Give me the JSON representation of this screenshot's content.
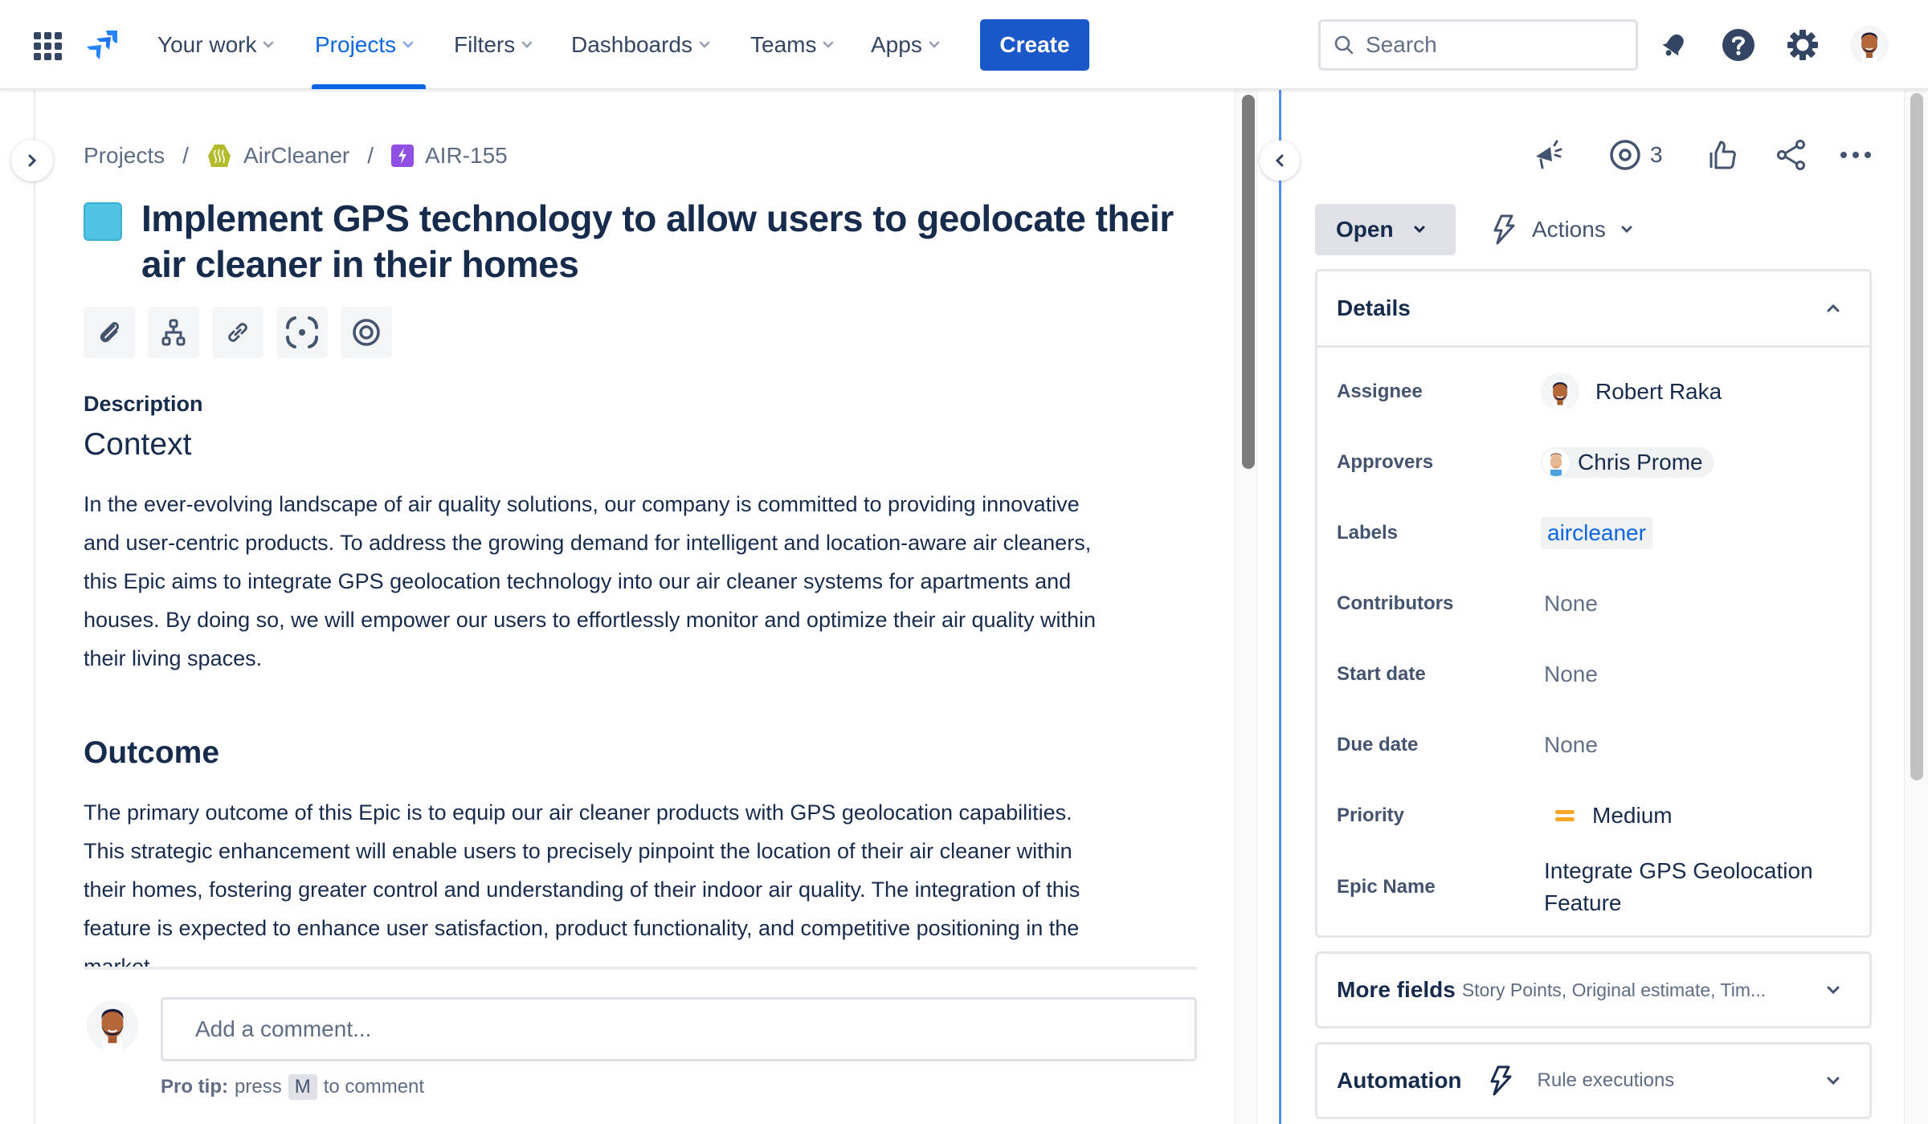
{
  "header": {
    "nav": [
      {
        "label": "Your work",
        "active": false
      },
      {
        "label": "Projects",
        "active": true
      },
      {
        "label": "Filters",
        "active": false
      },
      {
        "label": "Dashboards",
        "active": false
      },
      {
        "label": "Teams",
        "active": false
      },
      {
        "label": "Apps",
        "active": false
      }
    ],
    "create_label": "Create",
    "search_placeholder": "Search",
    "icons": [
      "app-switcher-icon",
      "jira-logo",
      "notifications-icon",
      "help-icon",
      "settings-icon",
      "profile-avatar"
    ],
    "accent_color": "#0c66e4"
  },
  "breadcrumb": {
    "items": [
      "Projects",
      "AirCleaner",
      "AIR-155"
    ],
    "separator": "/"
  },
  "issue": {
    "title": "Implement GPS technology to allow users to geolocate their air cleaner in their homes",
    "type_color": "#4fc3e3",
    "toolbar": [
      {
        "name": "attachment-icon"
      },
      {
        "name": "child-issues-icon"
      },
      {
        "name": "link-issue-icon"
      },
      {
        "name": "screen-record-icon"
      },
      {
        "name": "target-icon"
      }
    ],
    "description_label": "Description",
    "sections": [
      {
        "heading": "Context",
        "lines": [
          "In the ever-evolving landscape of air quality solutions, our company is committed to providing innovative",
          "and user-centric products. To address the growing demand for intelligent and location-aware air cleaners,",
          "this Epic aims to integrate GPS geolocation technology into our air cleaner systems for apartments and",
          "houses. By doing so, we will empower our users to effortlessly monitor and optimize their air quality within",
          "their living spaces."
        ]
      },
      {
        "heading": "Outcome",
        "lines": [
          "The primary outcome of this Epic is to equip our air cleaner products with GPS geolocation capabilities.",
          "This strategic enhancement will enable users to precisely pinpoint the location of their air cleaner within",
          "their homes, fostering greater control and understanding of their indoor air quality. The integration of this",
          "feature is expected to enhance user satisfaction, product functionality, and competitive positioning in the",
          "market."
        ]
      }
    ]
  },
  "comment": {
    "placeholder": "Add a comment...",
    "pro_tip_bold": "Pro tip:",
    "pro_tip_pre": "press",
    "pro_tip_key": "M",
    "pro_tip_post": "to comment"
  },
  "side": {
    "watch_count": "3",
    "status": "Open",
    "actions_label": "Actions",
    "details_title": "Details",
    "fields": [
      {
        "label": "Assignee",
        "value": "Robert Raka",
        "kind": "user"
      },
      {
        "label": "Approvers",
        "value": "Chris Prome",
        "kind": "chip"
      },
      {
        "label": "Labels",
        "value": "aircleaner",
        "kind": "label"
      },
      {
        "label": "Contributors",
        "value": "None",
        "kind": "none"
      },
      {
        "label": "Start date",
        "value": "None",
        "kind": "none"
      },
      {
        "label": "Due date",
        "value": "None",
        "kind": "none"
      },
      {
        "label": "Priority",
        "value": "Medium",
        "kind": "priority"
      },
      {
        "label": "Epic Name",
        "value": "Integrate GPS Geolocation Feature",
        "kind": "text"
      }
    ],
    "priority_color": "#f5a623",
    "more_fields_title": "More fields",
    "more_fields_sub": "Story Points, Original estimate, Tim...",
    "automation_title": "Automation",
    "automation_sub": "Rule executions"
  }
}
